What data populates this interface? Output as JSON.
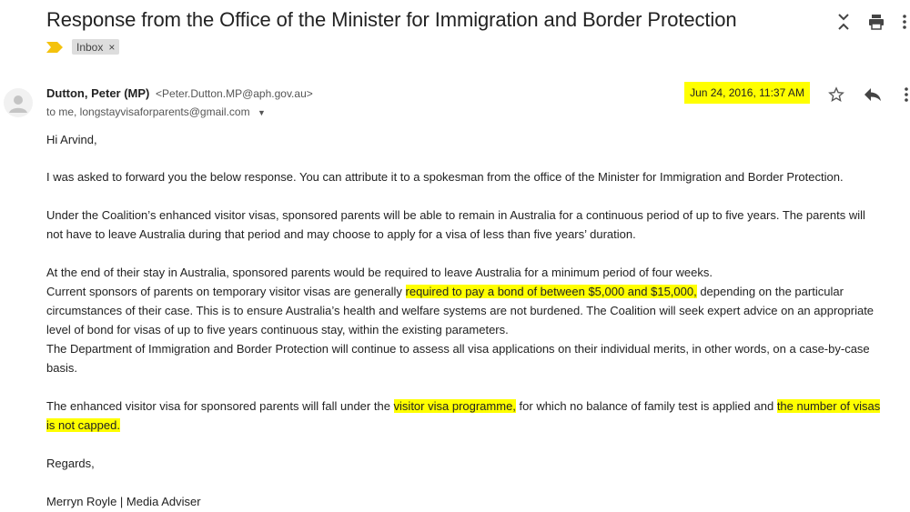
{
  "header": {
    "subject": "Response from the Office of the Minister for Immigration and Border Protection",
    "label_chip": "Inbox",
    "label_chip_close": "×",
    "icons": [
      "expand-collapse-icon",
      "print-icon",
      "more-vert-icon"
    ]
  },
  "message": {
    "sender_name": "Dutton, Peter (MP)",
    "sender_email": "<Peter.Dutton.MP@aph.gov.au>",
    "recipients": "to me, longstayvisaforparents@gmail.com",
    "date": "Jun 24, 2016, 11:37 AM",
    "actions": [
      "star-icon",
      "reply-icon",
      "more-vert-icon"
    ]
  },
  "body": {
    "greeting": "Hi Arvind,",
    "p1": "I was asked to forward you the below response. You can attribute it to a spokesman from the office of the Minister for Immigration and Border Protection.",
    "p2_l1": "Under the Coalition’s enhanced visitor visas, sponsored parents will be able to remain in Australia for a continuous period of up to five years.  The parents will",
    "p2_l2": "not have to leave Australia during that period and may choose to apply for a visa of less than five years’ duration.",
    "p3_l1": "At the end of their stay in Australia, sponsored parents would be required to leave Australia for a minimum period of four weeks.",
    "p3_l2a": "Current sponsors of parents on temporary visitor visas are generally ",
    "p3_l2b": "required to pay a bond of between $5,000 and $15,000,",
    "p3_l2c": " depending on the particular",
    "p3_l3": "circumstances of their case.  This is to ensure Australia’s health and welfare systems are not burdened. The Coalition will seek expert advice on an appropriate",
    "p3_l4": "level of bond for visas of up to five years continuous stay, within the existing parameters.",
    "p3_l5": "The Department of Immigration and Border Protection will continue to assess all visa applications on their individual merits, in other words, on a case-by-case",
    "p3_l6": "basis.",
    "p4_l1a": "The enhanced visitor visa for sponsored parents will fall under the ",
    "p4_l1b": "visitor visa programme,",
    "p4_l1c": " for which no balance of family test is applied and ",
    "p4_l1d": "the number of visas",
    "p4_l2": "is not capped.",
    "regards": "Regards,",
    "signature": "Merryn Royle | Media Adviser"
  },
  "colors": {
    "highlight": "#ffff00",
    "label_marker": "#f4c20d",
    "chip_bg": "#dddddd",
    "text": "#222222"
  }
}
